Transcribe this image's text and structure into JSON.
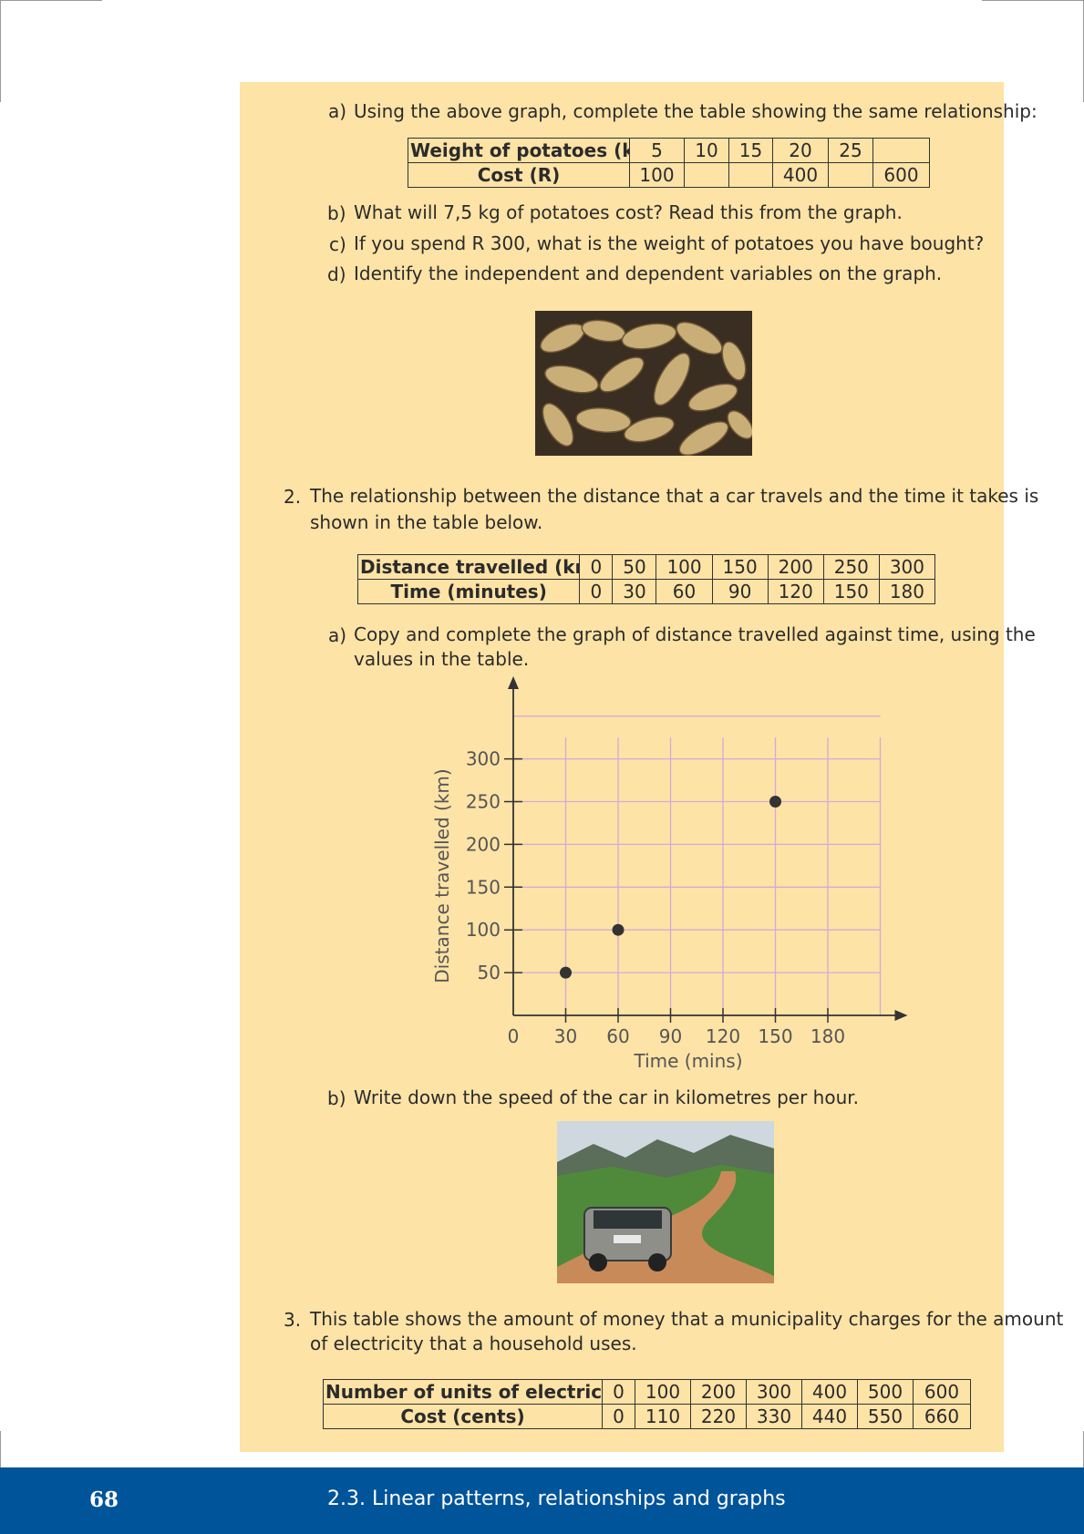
{
  "question1": {
    "part_a": {
      "marker": "a)",
      "text": "Using the above graph, complete the table showing the same relationship:",
      "table": {
        "row1_header": "Weight of potatoes (kg)",
        "row1": [
          "5",
          "10",
          "15",
          "20",
          "25",
          ""
        ],
        "row2_header": "Cost (R)",
        "row2": [
          "100",
          "",
          "",
          "400",
          "",
          "600"
        ]
      }
    },
    "part_b": {
      "marker": "b)",
      "text": "What will 7,5 kg of potatoes cost? Read this from the graph."
    },
    "part_c": {
      "marker": "c)",
      "text": "If you spend R 300, what is the weight of potatoes you have bought?"
    },
    "part_d": {
      "marker": "d)",
      "text": "Identify the independent and dependent variables on the graph."
    }
  },
  "question2": {
    "number": "2.",
    "text_line1": "The relationship between the distance that a car travels and the time it takes is",
    "text_line2": "shown in the table below.",
    "table": {
      "row1_header": "Distance travelled (km)",
      "row1": [
        "0",
        "50",
        "100",
        "150",
        "200",
        "250",
        "300"
      ],
      "row2_header": "Time (minutes)",
      "row2": [
        "0",
        "30",
        "60",
        "90",
        "120",
        "150",
        "180"
      ]
    },
    "part_a": {
      "marker": "a)",
      "line1": "Copy and complete the graph of distance travelled against time, using the",
      "line2": "values in the table."
    },
    "part_b": {
      "marker": "b)",
      "text": "Write down the speed of the car in kilometres per hour."
    }
  },
  "chart_data": {
    "type": "scatter",
    "xlabel": "Time (mins)",
    "ylabel": "Distance travelled (km)",
    "x_ticks": [
      0,
      30,
      60,
      90,
      120,
      150,
      180
    ],
    "y_ticks": [
      50,
      100,
      150,
      200,
      250,
      300
    ],
    "xlim": [
      0,
      210
    ],
    "ylim": [
      0,
      350
    ],
    "grid": true,
    "grid_color": "#d9a8d6",
    "point_color": "#333333",
    "points": [
      {
        "x": 30,
        "y": 50
      },
      {
        "x": 60,
        "y": 100
      },
      {
        "x": 150,
        "y": 250
      }
    ]
  },
  "question3": {
    "number": "3.",
    "text_line1": "This table shows the amount of money that a municipality charges for the amount",
    "text_line2": "of electricity that a household uses.",
    "table": {
      "row1_header": "Number of units of electricity",
      "row1": [
        "0",
        "100",
        "200",
        "300",
        "400",
        "500",
        "600"
      ],
      "row2_header": "Cost (cents)",
      "row2": [
        "0",
        "110",
        "220",
        "330",
        "440",
        "550",
        "660"
      ]
    }
  },
  "footer": {
    "page_number": "68",
    "section": "2.3.   Linear patterns, relationships and graphs"
  },
  "colors": {
    "panel": "#fde3a6",
    "footer": "#00549a"
  }
}
